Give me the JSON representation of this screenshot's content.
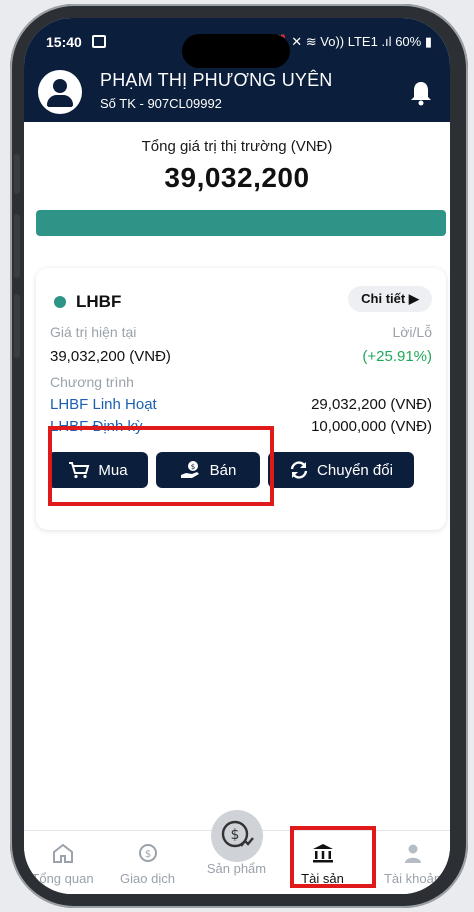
{
  "status_bar": {
    "time": "15:40",
    "battery": "60%",
    "network": "Vo)) LTE1 .ıl"
  },
  "header": {
    "user_name": "PHẠM THỊ PHƯƠNG UYÊN",
    "account": "Số TK - 907CL09992"
  },
  "summary": {
    "title": "Tổng giá trị thị trường (VNĐ)",
    "value": "39,032,200",
    "bar_fill_fraction": 1.0,
    "bar_color": "#2e9488"
  },
  "fund_card": {
    "name": "LHBF",
    "detail_button": "Chi tiết ▶",
    "current_value_label": "Giá trị hiện tại",
    "current_value": "39,032,200 (VNĐ)",
    "pnl_label": "Lời/Lỗ",
    "pnl_value": "(+25.91%)",
    "program_label": "Chương trình",
    "programs": [
      {
        "name": "LHBF Linh Hoạt",
        "amount": "29,032,200 (VNĐ)"
      },
      {
        "name": "LHBF Định kỳ",
        "amount": "10,000,000 (VNĐ)"
      }
    ],
    "actions": {
      "buy": "Mua",
      "sell": "Bán",
      "convert": "Chuyển đổi"
    }
  },
  "tabbar": {
    "tabs": [
      {
        "label": "Tổng quan",
        "icon": "home-icon"
      },
      {
        "label": "Giao dịch",
        "icon": "transaction-icon"
      },
      {
        "label": "Sản phẩm",
        "icon": "product-icon"
      },
      {
        "label": "Tài sản",
        "icon": "bank-icon",
        "active": true
      },
      {
        "label": "Tài khoản",
        "icon": "user-icon"
      }
    ]
  },
  "colors": {
    "navy": "#0b1e3b",
    "teal": "#2e9488",
    "highlight_red": "#e0191b",
    "profit_green": "#1fa85a"
  }
}
